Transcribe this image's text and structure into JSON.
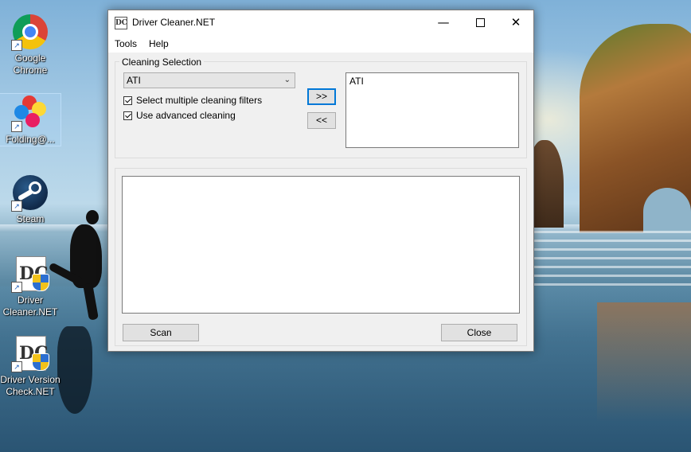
{
  "desktop": {
    "icons": [
      {
        "label": "Google Chrome",
        "icon": "chrome-icon"
      },
      {
        "label": "Folding@...",
        "icon": "folding-at-home-icon"
      },
      {
        "label": "Steam",
        "icon": "steam-icon"
      },
      {
        "label": "Driver Cleaner.NET",
        "icon": "driver-cleaner-icon"
      },
      {
        "label": "Driver Version Check.NET",
        "icon": "driver-version-check-icon"
      }
    ],
    "shortcut_glyph": "↗"
  },
  "window": {
    "title": "Driver Cleaner.NET",
    "app_icon_text": "DC",
    "controls": {
      "minimize": "—",
      "close": "✕"
    },
    "menu": [
      "Tools",
      "Help"
    ],
    "cleaning_selection": {
      "legend": "Cleaning Selection",
      "combo_value": "ATI",
      "combo_chevron": "⌄",
      "checkboxes": [
        {
          "label": "Select multiple cleaning filters",
          "checked": true
        },
        {
          "label": "Use advanced cleaning",
          "checked": true
        }
      ],
      "add_button": ">>",
      "remove_button": "<<",
      "selected_items": [
        "ATI"
      ]
    },
    "scan_button": "Scan",
    "close_button": "Close"
  }
}
